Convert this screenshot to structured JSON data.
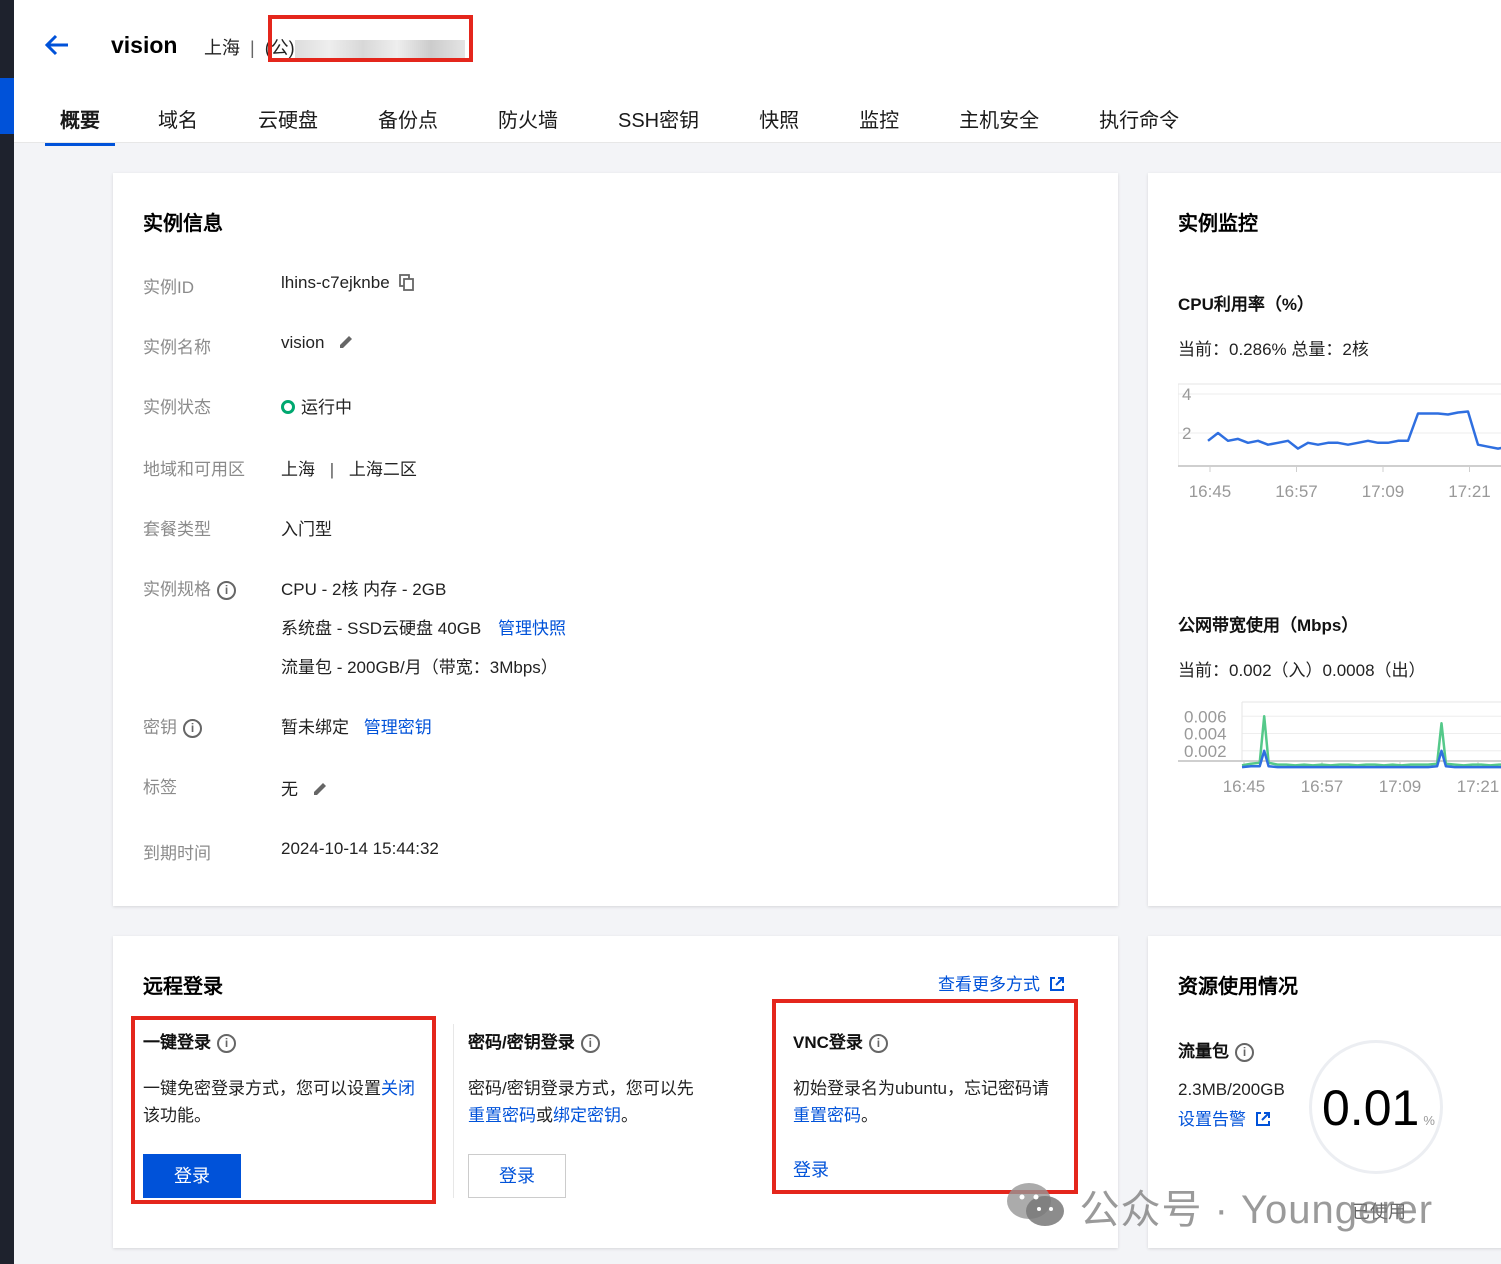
{
  "header": {
    "title": "vision",
    "region": "上海",
    "separator": "|",
    "ip_prefix": "(公)"
  },
  "tabs": [
    "概要",
    "域名",
    "云硬盘",
    "备份点",
    "防火墙",
    "SSH密钥",
    "快照",
    "监控",
    "主机安全",
    "执行命令"
  ],
  "instance_info": {
    "title": "实例信息",
    "rows": {
      "id_label": "实例ID",
      "id_value": "lhins-c7ejknbe",
      "name_label": "实例名称",
      "name_value": "vision",
      "status_label": "实例状态",
      "status_value": "运行中",
      "zone_label": "地域和可用区",
      "zone_region": "上海",
      "zone_sep": "|",
      "zone_zone": "上海二区",
      "plan_label": "套餐类型",
      "plan_value": "入门型",
      "spec_label": "实例规格",
      "spec_cpu": "CPU - 2核 内存 - 2GB",
      "spec_disk": "系统盘 - SSD云硬盘 40GB",
      "spec_disk_link": "管理快照",
      "spec_traffic": "流量包 - 200GB/月（带宽：3Mbps）",
      "key_label": "密钥",
      "key_value": "暂未绑定",
      "key_link": "管理密钥",
      "tag_label": "标签",
      "tag_value": "无",
      "expire_label": "到期时间",
      "expire_value": "2024-10-14 15:44:32"
    }
  },
  "monitor": {
    "title": "实例监控",
    "cpu_title": "CPU利用率（%）",
    "cpu_current": "当前：0.286% 总量：2核",
    "bw_title": "公网带宽使用（Mbps）",
    "bw_current": "当前：0.002（入）0.0008（出）"
  },
  "chart_data": [
    {
      "type": "line",
      "title": "CPU利用率（%）",
      "x_ticks": [
        "16:45",
        "16:57",
        "17:09",
        "17:21"
      ],
      "y_ticks": [
        "4",
        "2"
      ],
      "ylim": [
        0,
        4
      ],
      "series": [
        {
          "color": "#2f6fe0",
          "x": [
            0,
            2,
            4,
            6,
            8,
            10,
            12,
            14,
            16,
            18,
            20,
            22,
            24,
            26,
            28,
            30,
            32,
            34,
            36,
            38,
            40,
            42,
            44,
            46,
            48,
            50,
            52,
            54,
            56,
            58,
            60
          ],
          "values": [
            1.6,
            2.0,
            1.6,
            1.7,
            1.5,
            1.6,
            1.4,
            1.5,
            1.6,
            1.2,
            1.5,
            1.4,
            1.5,
            1.5,
            1.4,
            1.5,
            1.6,
            1.5,
            1.5,
            1.6,
            1.6,
            3.0,
            3.0,
            3.0,
            2.95,
            3.05,
            3.1,
            1.4,
            1.3,
            1.2,
            1.3
          ]
        }
      ]
    },
    {
      "type": "line",
      "title": "公网带宽使用（Mbps）",
      "x_ticks": [
        "16:45",
        "16:57",
        "17:09",
        "17:21"
      ],
      "y_ticks": [
        "0.006",
        "0.004",
        "0.002"
      ],
      "ylim": [
        0,
        0.0065
      ],
      "series": [
        {
          "color": "#55c98a",
          "x": [
            0,
            2,
            4,
            5,
            6,
            8,
            10,
            12,
            14,
            16,
            18,
            20,
            22,
            24,
            26,
            28,
            30,
            32,
            34,
            36,
            38,
            40,
            42,
            44,
            45,
            46,
            48,
            50,
            52,
            54,
            56,
            58,
            60
          ],
          "values": [
            0.0003,
            0.0005,
            0.0006,
            0.006,
            0.0006,
            0.0004,
            0.0004,
            0.0003,
            0.0004,
            0.0003,
            0.0004,
            0.0003,
            0.0004,
            0.0004,
            0.0003,
            0.0004,
            0.0004,
            0.0003,
            0.0004,
            0.0003,
            0.0004,
            0.0004,
            0.0004,
            0.0005,
            0.0052,
            0.0005,
            0.0004,
            0.0003,
            0.0004,
            0.0004,
            0.0003,
            0.0004,
            0.0004
          ]
        },
        {
          "color": "#2f6fe0",
          "x": [
            0,
            2,
            4,
            5,
            6,
            8,
            10,
            12,
            14,
            16,
            18,
            20,
            22,
            24,
            26,
            28,
            30,
            32,
            34,
            36,
            38,
            40,
            42,
            44,
            45,
            46,
            48,
            50,
            52,
            54,
            56,
            58,
            60
          ],
          "values": [
            0.0001,
            0.0002,
            0.0002,
            0.002,
            0.0002,
            0.0001,
            0.0001,
            0.0001,
            0.0001,
            0.0001,
            0.0001,
            0.0001,
            0.0001,
            0.0001,
            0.0001,
            0.0001,
            0.0001,
            0.0001,
            0.0001,
            0.0001,
            0.0001,
            0.0001,
            0.0001,
            0.0002,
            0.002,
            0.0002,
            0.0001,
            0.0001,
            0.0001,
            0.0001,
            0.0001,
            0.0001,
            0.0001
          ]
        }
      ]
    }
  ],
  "remote_login": {
    "title": "远程登录",
    "more_link": "查看更多方式",
    "one_click": {
      "title": "一键登录",
      "desc_1": "一键免密登录方式，您可以设置",
      "desc_link": "关闭",
      "desc_2": "该功能。",
      "button": "登录"
    },
    "password": {
      "title": "密码/密钥登录",
      "desc_1": "密码/密钥登录方式，您可以先",
      "link_reset": "重置密码",
      "or": "或",
      "link_bind": "绑定密钥",
      "end": "。",
      "button": "登录"
    },
    "vnc": {
      "title": "VNC登录",
      "desc_1": "初始登录名为ubuntu，忘记密码请",
      "link_reset": "重置密码",
      "end": "。",
      "button": "登录"
    }
  },
  "resource": {
    "title": "资源使用情况",
    "traffic_label": "流量包",
    "traffic_value": "2.3MB/200GB",
    "alert_link": "设置告警",
    "percent": "0.01",
    "percent_unit": "%",
    "used_label": "已使用"
  },
  "watermark": "公众号 · Youngerer",
  "colors": {
    "accent": "#0052d9",
    "highlight_box": "#e4261c",
    "running": "#00a870"
  }
}
